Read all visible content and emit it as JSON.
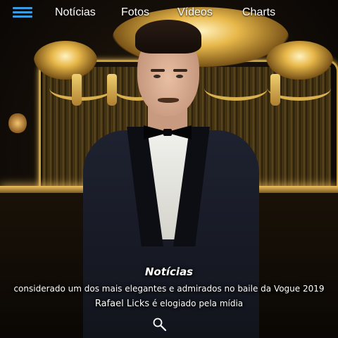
{
  "nav": {
    "items": [
      {
        "label": "Notícias"
      },
      {
        "label": "Fotos"
      },
      {
        "label": "Vídeos"
      },
      {
        "label": "Charts"
      }
    ],
    "menu_icon": "hamburger-menu-icon",
    "menu_icon_color": "#3b9be0"
  },
  "hero": {
    "category": "Notícias",
    "subtitle": "considerado um dos mais elegantes e admirados no baile da Vogue 2019",
    "name": "Rafael Licks",
    "name_suffix": "é elogiado pela mídia",
    "search_icon": "search-icon"
  },
  "colors": {
    "accent": "#3b9be0",
    "text": "#ffffff",
    "gold": "#e8b84a"
  }
}
